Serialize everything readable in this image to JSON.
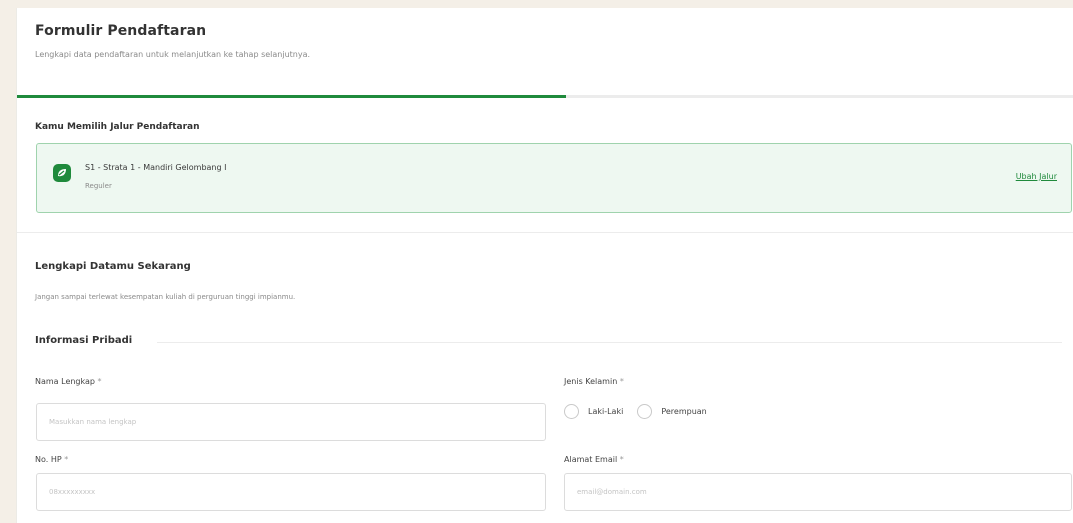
{
  "form": {
    "title": "Formulir Pendaftaran",
    "subtitle": "Lengkapi data pendaftaran untuk melanjutkan ke tahap selanjutnya.",
    "progress_fraction": 0.52
  },
  "jalur": {
    "heading": "Kamu Memilih Jalur Pendaftaran",
    "name": "S1 - Strata 1 - Mandiri Gelombang I",
    "type": "Reguler",
    "change_label": "Ubah Jalur"
  },
  "data_section": {
    "heading": "Lengkapi Datamu Sekarang",
    "subheading": "Jangan sampai terlewat kesempatan kuliah di perguruan tinggi impianmu.",
    "info_heading": "Informasi Pribadi"
  },
  "fields": {
    "nama": {
      "label": "Nama Lengkap",
      "required_mark": "*",
      "placeholder": "Masukkan nama lengkap",
      "value": ""
    },
    "jenis_kelamin": {
      "label": "Jenis Kelamin",
      "required_mark": "*",
      "options": [
        "Laki-Laki",
        "Perempuan"
      ]
    },
    "hp": {
      "label": "No. HP",
      "required_mark": "*",
      "placeholder": "08xxxxxxxxx",
      "value": ""
    },
    "email": {
      "label": "Alamat Email",
      "required_mark": "*",
      "placeholder": "email@domain.com",
      "value": ""
    }
  },
  "colors": {
    "accent": "#1f8a3c",
    "jalur_bg": "#eef8f1",
    "jalur_border": "#9fd3ad",
    "page_bg": "#f4efe7"
  },
  "icons": {
    "jalur": "leaf-badge-icon",
    "radio": "radio-circle-icon"
  }
}
